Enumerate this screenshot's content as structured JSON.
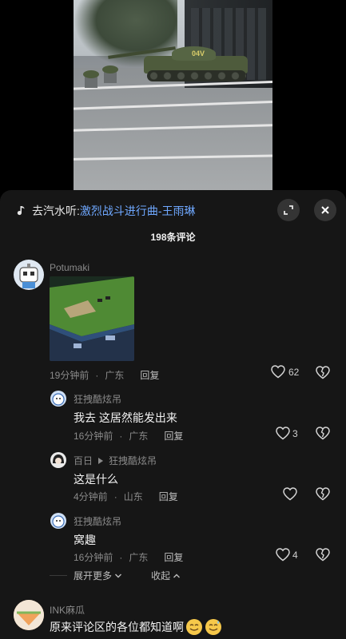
{
  "music": {
    "prefix": "去汽水听: ",
    "song": "激烈战斗进行曲-王雨琳"
  },
  "comments_title": "198条评论",
  "tank_number": "04V",
  "comments": [
    {
      "user": "Potumaki",
      "time": "19分钟前",
      "location": "广东",
      "reply": "回复",
      "likes": "62"
    },
    {
      "user": "狂拽酷炫吊",
      "text": "我去 这居然能发出来",
      "time": "16分钟前",
      "location": "广东",
      "reply": "回复",
      "likes": "3"
    },
    {
      "user": "百日",
      "reply_to": "狂拽酷炫吊",
      "text": "这是什么",
      "time": "4分钟前",
      "location": "山东",
      "reply": "回复"
    },
    {
      "user": "狂拽酷炫吊",
      "text": "窝趣",
      "time": "16分钟前",
      "location": "广东",
      "reply": "回复",
      "likes": "4"
    },
    {
      "user": "INK麻瓜",
      "text": "原来评论区的各位都知道啊"
    }
  ],
  "expand_more": "展开更多",
  "collapse": "收起",
  "colors": {
    "link": "#6fa8ff",
    "sheet_bg": "#161616"
  }
}
